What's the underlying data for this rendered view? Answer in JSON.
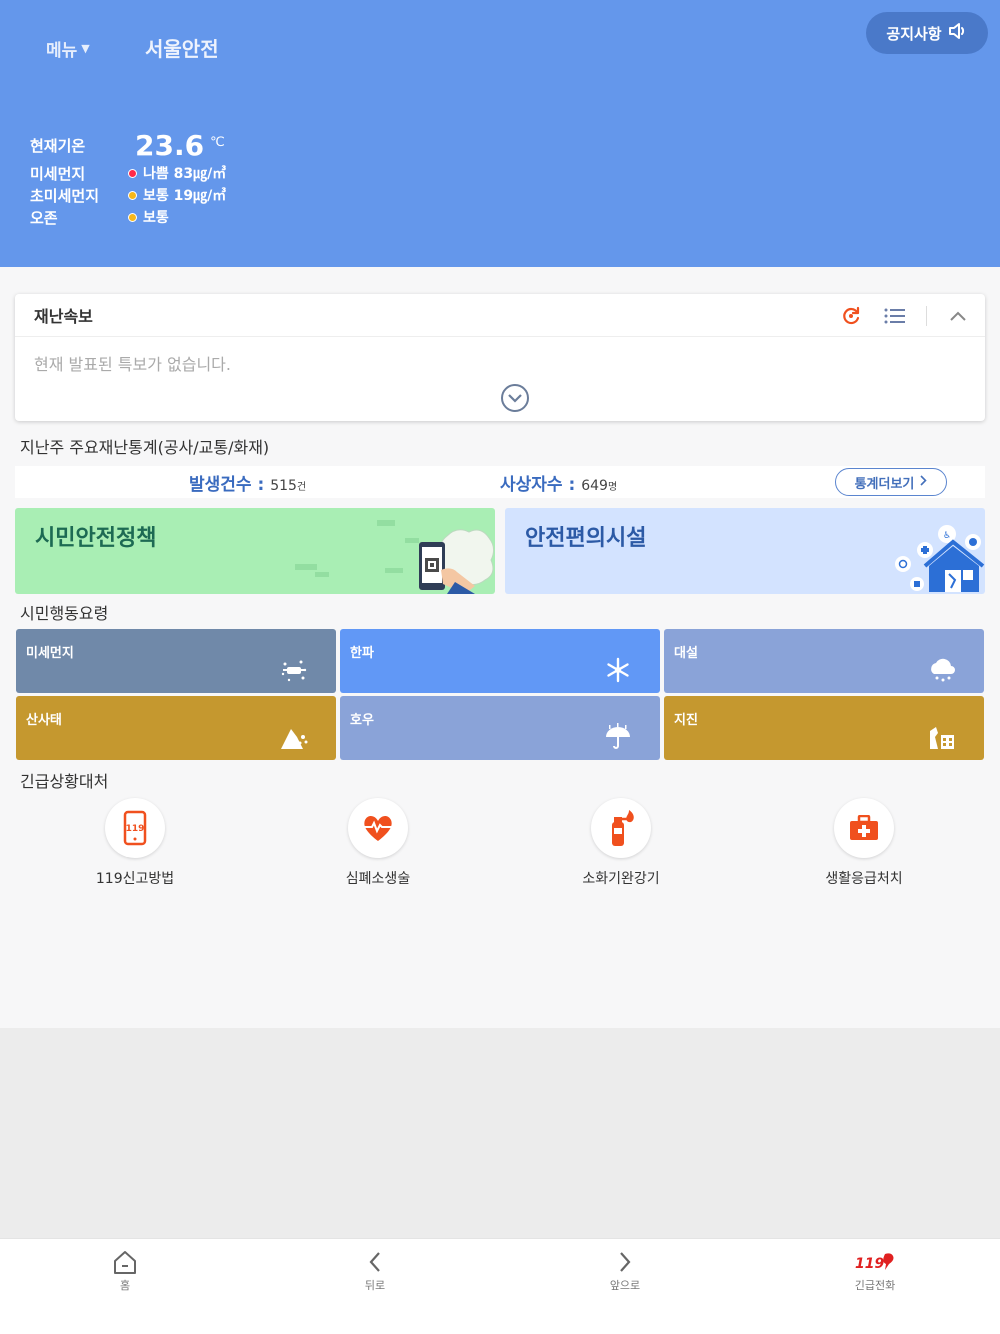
{
  "header": {
    "menu_label": "메뉴",
    "app_title": "서울안전",
    "notice_label": "공지사항",
    "bg_color": "#6497eb"
  },
  "weather": {
    "temp_label": "현재기온",
    "temp_value": "23.6",
    "temp_unit": "℃",
    "pm10_label": "미세먼지",
    "pm10_value": "나쁨 83㎍/㎥",
    "pm10_status_color": "#ff2a4a",
    "pm25_label": "초미세먼지",
    "pm25_value": "보통 19㎍/㎥",
    "pm25_status_color": "#f7b71a",
    "ozone_label": "오존",
    "ozone_value": "보통",
    "ozone_status_color": "#f7b71a"
  },
  "alert": {
    "title": "재난속보",
    "message": "현재 발표된 특보가 없습니다.",
    "icons": [
      "refresh-icon",
      "list-icon",
      "chevron-up-icon",
      "chevron-down-circle-icon"
    ]
  },
  "stats": {
    "title": "지난주 주요재난통계(공사/교통/화재)",
    "occurrence_label": "발생건수 :",
    "occurrence_value": "515",
    "occurrence_unit": "건",
    "casualty_label": "사상자수 :",
    "casualty_value": "649",
    "casualty_unit": "명",
    "more_label": "통계더보기"
  },
  "banners": {
    "policy_title": "시민안전정책",
    "facility_title": "안전편의시설"
  },
  "guidelines": {
    "title": "시민행동요령",
    "tiles": [
      {
        "label": "미세먼지",
        "icon": "dust-icon",
        "color": "#7089a9"
      },
      {
        "label": "한파",
        "icon": "snowflake-icon",
        "color": "#6198f6"
      },
      {
        "label": "대설",
        "icon": "snow-cloud-icon",
        "color": "#8aa3d8"
      },
      {
        "label": "산사태",
        "icon": "landslide-icon",
        "color": "#c5982f"
      },
      {
        "label": "호우",
        "icon": "umbrella-icon",
        "color": "#8aa3d8"
      },
      {
        "label": "지진",
        "icon": "earthquake-icon",
        "color": "#c5982f"
      }
    ]
  },
  "emergency": {
    "title": "긴급상황대처",
    "items": [
      {
        "label": "119신고방법",
        "icon": "phone-icon"
      },
      {
        "label": "심폐소생술",
        "icon": "heart-icon"
      },
      {
        "label": "소화기완강기",
        "icon": "extinguisher-icon"
      },
      {
        "label": "생활응급처치",
        "icon": "first-aid-icon"
      }
    ],
    "accent_color": "#f0501e"
  },
  "nav": {
    "home": "홈",
    "back": "뒤로",
    "forward": "앞으로",
    "call": "긴급전화",
    "call_logo": "119"
  }
}
